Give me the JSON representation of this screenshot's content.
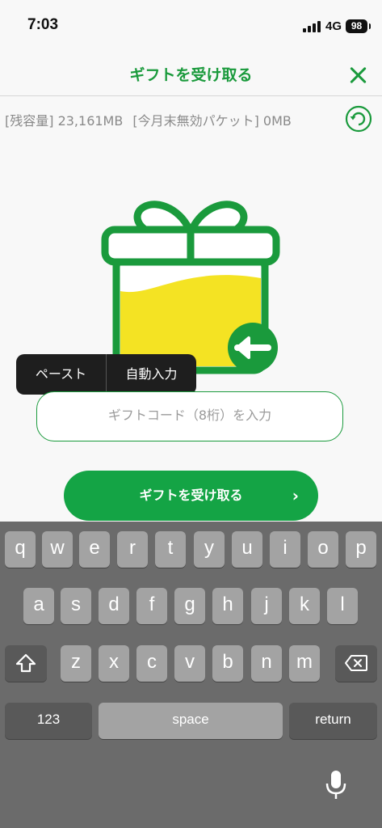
{
  "status": {
    "time": "7:03",
    "network": "4G",
    "battery": "98"
  },
  "header": {
    "title": "ギフトを受け取る",
    "close_icon": "close-icon"
  },
  "capacity": {
    "remaining": "[残容量] 23,161MB",
    "month_end": "[今月末無効パケット] 0MB"
  },
  "paste_menu": {
    "paste": "ペースト",
    "autofill": "自動入力"
  },
  "gift_input": {
    "placeholder": "ギフトコード（8桁）を入力"
  },
  "receive_button": {
    "label": "ギフトを受け取る",
    "chevron": "›"
  },
  "keyboard": {
    "row1": [
      "q",
      "w",
      "e",
      "r",
      "t",
      "y",
      "u",
      "i",
      "o",
      "p"
    ],
    "row2": [
      "a",
      "s",
      "d",
      "f",
      "g",
      "h",
      "j",
      "k",
      "l"
    ],
    "row3": [
      "z",
      "x",
      "c",
      "v",
      "b",
      "n",
      "m"
    ],
    "numbers": "123",
    "space": "space",
    "return": "return"
  },
  "colors": {
    "accent": "#1a9a3c",
    "gift_fill": "#f4e323",
    "keyboard_bg": "#6b6b6b"
  }
}
